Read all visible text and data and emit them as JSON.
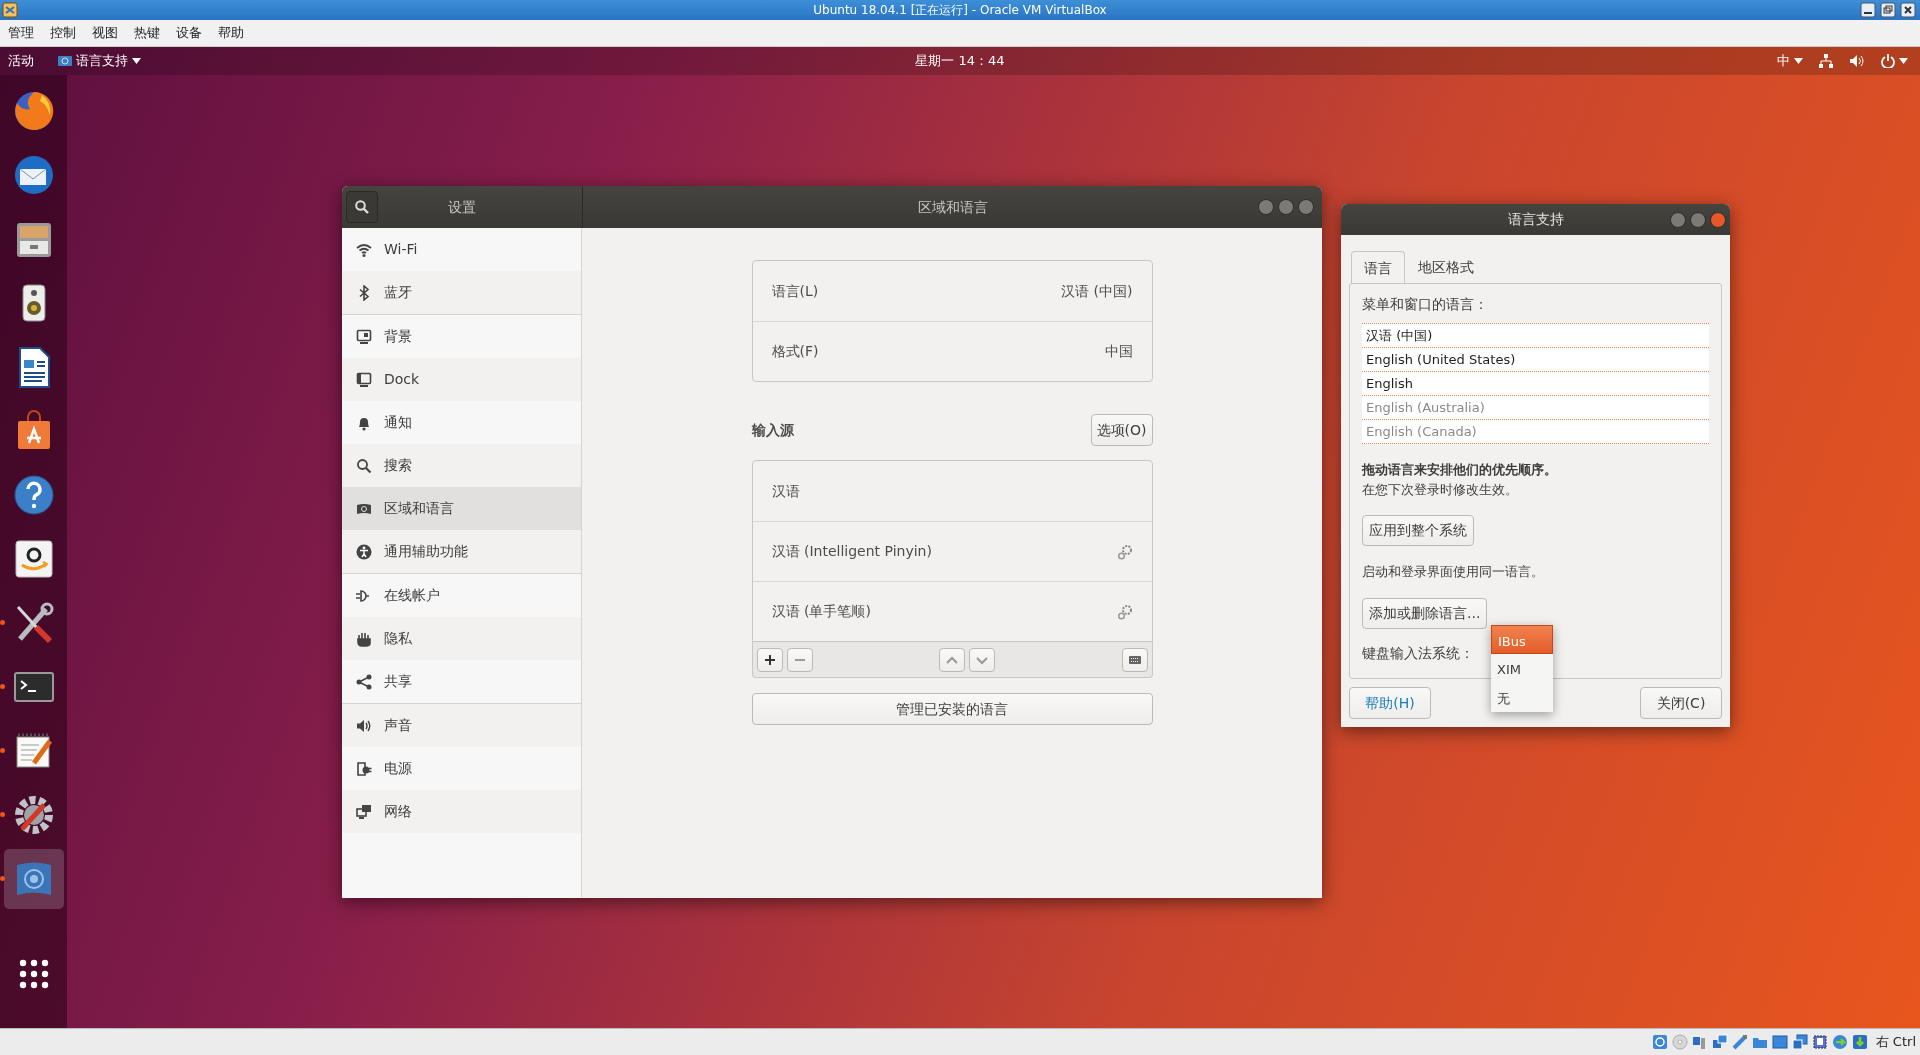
{
  "vbox": {
    "title": "Ubuntu 18.04.1 [正在运行] - Oracle VM VirtualBox",
    "menu": [
      "管理",
      "控制",
      "视图",
      "热键",
      "设备",
      "帮助"
    ],
    "host_key": "右 Ctrl"
  },
  "top_bar": {
    "activities": "活动",
    "app_menu": "语言支持",
    "clock": "星期一 14：44",
    "input_method": "中"
  },
  "dock": {
    "items": [
      {
        "kind": "browser",
        "running": false,
        "selected": false
      },
      {
        "kind": "mail",
        "running": false,
        "selected": false
      },
      {
        "kind": "files",
        "running": false,
        "selected": false
      },
      {
        "kind": "speaker",
        "running": false,
        "selected": false
      },
      {
        "kind": "document",
        "running": false,
        "selected": false
      },
      {
        "kind": "store",
        "running": false,
        "selected": false
      },
      {
        "kind": "help",
        "running": false,
        "selected": false
      },
      {
        "kind": "shop",
        "running": false,
        "selected": false
      },
      {
        "kind": "tools",
        "running": true,
        "selected": false
      },
      {
        "kind": "terminal",
        "running": true,
        "selected": false
      },
      {
        "kind": "editor",
        "running": true,
        "selected": false
      },
      {
        "kind": "settings",
        "running": true,
        "selected": false
      },
      {
        "kind": "language",
        "running": true,
        "selected": true
      }
    ]
  },
  "settings": {
    "header_title": "设置",
    "title": "区域和语言",
    "sidebar_groups": [
      {
        "items": [
          {
            "label": "Wi-Fi",
            "kind": "wifi",
            "selected": false
          },
          {
            "label": "蓝牙",
            "kind": "bluetooth",
            "selected": false
          }
        ]
      },
      {
        "items": [
          {
            "label": "背景",
            "kind": "background",
            "selected": false
          },
          {
            "label": "Dock",
            "kind": "dock",
            "selected": false
          },
          {
            "label": "通知",
            "kind": "bell",
            "selected": false
          },
          {
            "label": "搜索",
            "kind": "search",
            "selected": false
          },
          {
            "label": "区域和语言",
            "kind": "region",
            "selected": true
          },
          {
            "label": "通用辅助功能",
            "kind": "accessibility",
            "selected": false
          }
        ]
      },
      {
        "items": [
          {
            "label": "在线帐户",
            "kind": "accounts",
            "selected": false
          },
          {
            "label": "隐私",
            "kind": "hand",
            "selected": false
          },
          {
            "label": "共享",
            "kind": "share",
            "selected": false
          }
        ]
      },
      {
        "items": [
          {
            "label": "声音",
            "kind": "sound",
            "selected": false
          },
          {
            "label": "电源",
            "kind": "power",
            "selected": false
          },
          {
            "label": "网络",
            "kind": "network",
            "selected": false
          }
        ]
      }
    ],
    "region_rows": [
      {
        "label": "语言(L)",
        "value": "汉语 (中国)"
      },
      {
        "label": "格式(F)",
        "value": "中国"
      }
    ],
    "input_sources_title": "输入源",
    "options_button": "选项(O)",
    "input_sources": [
      {
        "label": "汉语",
        "has_settings": false
      },
      {
        "label": "汉语 (Intelligent Pinyin)",
        "has_settings": true
      },
      {
        "label": "汉语 (单手笔顺)",
        "has_settings": true
      }
    ],
    "manage_button": "管理已安装的语言"
  },
  "language_support": {
    "title": "语言支持",
    "tabs": [
      {
        "label": "语言",
        "selected": true
      },
      {
        "label": "地区格式",
        "selected": false
      }
    ],
    "list_label": "菜单和窗口的语言：",
    "languages": [
      {
        "label": "汉语 (中国)",
        "enabled": true
      },
      {
        "label": "English (United States)",
        "enabled": true
      },
      {
        "label": "English",
        "enabled": true
      },
      {
        "label": "English (Australia)",
        "enabled": false
      },
      {
        "label": "English (Canada)",
        "enabled": false
      }
    ],
    "drag_hint": "拖动语言来安排他们的优先顺序。",
    "apply_note": "在您下次登录时修改生效。",
    "apply_button": "应用到整个系统",
    "login_note": "启动和登录界面使用同一语言。",
    "add_button": "添加或删除语言...",
    "im_label": "键盘输入法系统：",
    "im_options": [
      {
        "label": "IBus",
        "selected": true
      },
      {
        "label": "XIM",
        "selected": false
      },
      {
        "label": "无",
        "selected": false
      }
    ],
    "help_button": "帮助(H)",
    "close_button": "关闭(C)"
  }
}
